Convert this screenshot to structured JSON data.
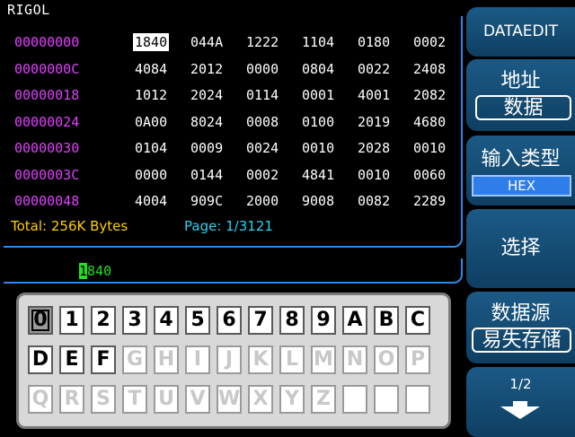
{
  "brand": "RIGOL",
  "hex": {
    "rows": [
      {
        "addr": "00000000",
        "bytes": [
          "1840",
          "044A",
          "1222",
          "1104",
          "0180",
          "0002"
        ]
      },
      {
        "addr": "0000000C",
        "bytes": [
          "4084",
          "2012",
          "0000",
          "0804",
          "0022",
          "2408"
        ]
      },
      {
        "addr": "00000018",
        "bytes": [
          "1012",
          "2024",
          "0114",
          "0001",
          "4001",
          "2082"
        ]
      },
      {
        "addr": "00000024",
        "bytes": [
          "0A00",
          "8024",
          "0008",
          "0100",
          "2019",
          "4680"
        ]
      },
      {
        "addr": "00000030",
        "bytes": [
          "0104",
          "0009",
          "0024",
          "0010",
          "2028",
          "0010"
        ]
      },
      {
        "addr": "0000003C",
        "bytes": [
          "0000",
          "0144",
          "0002",
          "4841",
          "0010",
          "0060"
        ]
      },
      {
        "addr": "00000048",
        "bytes": [
          "4004",
          "909C",
          "2000",
          "9008",
          "0082",
          "2289"
        ]
      }
    ],
    "selected": {
      "row": 0,
      "col": 0
    },
    "total": "Total: 256K Bytes",
    "page": "Page: 1/3121"
  },
  "edit": {
    "cursor_char": "1",
    "rest": "840"
  },
  "keyboard": {
    "rows": [
      [
        "0",
        "1",
        "2",
        "3",
        "4",
        "5",
        "6",
        "7",
        "8",
        "9",
        "A",
        "B",
        "C"
      ],
      [
        "D",
        "E",
        "F",
        "G",
        "H",
        "I",
        "J",
        "K",
        "L",
        "M",
        "N",
        "O",
        "P"
      ],
      [
        "Q",
        "R",
        "S",
        "T",
        "U",
        "V",
        "W",
        "X",
        "Y",
        "Z",
        "",
        "",
        ""
      ]
    ],
    "enabled": [
      "0",
      "1",
      "2",
      "3",
      "4",
      "5",
      "6",
      "7",
      "8",
      "9",
      "A",
      "B",
      "C",
      "D",
      "E",
      "F"
    ],
    "current": "0"
  },
  "menu": {
    "dataedit": "DATAEDIT",
    "addr_label": "地址",
    "addr_value": "数据",
    "input_type_label": "输入类型",
    "input_type_value": "HEX",
    "select_label": "选择",
    "source_label": "数据源",
    "source_value": "易失存储",
    "page_label": "1/2"
  },
  "colors": {
    "address": "#e040ff",
    "total": "#ffd000",
    "page": "#2bd1f0",
    "edit": "#20e020",
    "frame": "#2c8be6",
    "menu": "#1b5a86"
  }
}
